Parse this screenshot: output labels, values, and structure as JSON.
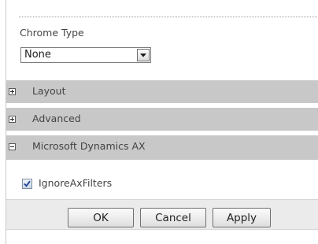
{
  "chrome_type": {
    "label": "Chrome Type",
    "selected": "None"
  },
  "sections": [
    {
      "label": "Layout",
      "expander": "+",
      "expanded": false
    },
    {
      "label": "Advanced",
      "expander": "+",
      "expanded": false
    },
    {
      "label": "Microsoft Dynamics AX",
      "expander": "−",
      "expanded": true
    }
  ],
  "options": {
    "ignore_ax_filters": {
      "label": "IgnoreAxFilters",
      "checked": true
    }
  },
  "buttons": {
    "ok": "OK",
    "cancel": "Cancel",
    "apply": "Apply"
  },
  "colors": {
    "section_header": "#c8c8c8",
    "button_bar": "#ebebeb",
    "checkmark": "#1c3f94"
  },
  "icons": {
    "dropdown": "chevron-down-icon",
    "collapsed": "plus-icon",
    "expanded": "minus-icon",
    "check": "checkmark-icon"
  }
}
